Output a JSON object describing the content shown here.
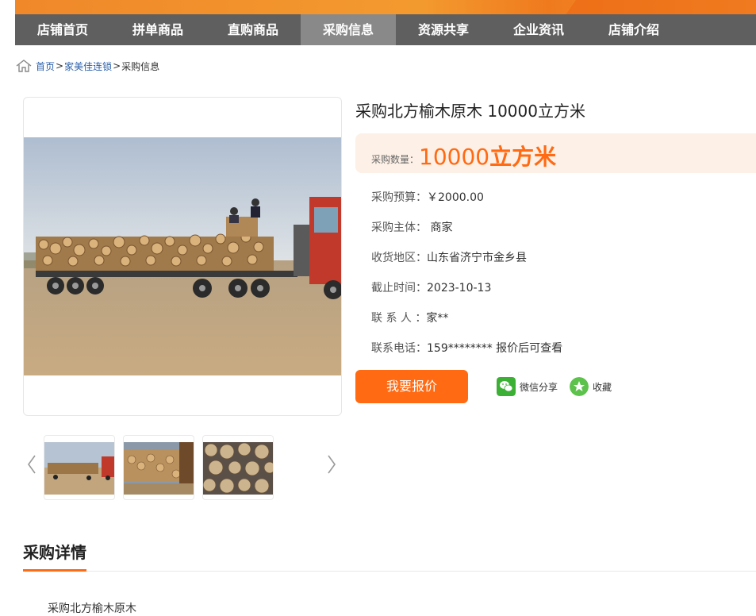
{
  "nav": {
    "items": [
      {
        "label": "店铺首页"
      },
      {
        "label": "拼单商品"
      },
      {
        "label": "直购商品"
      },
      {
        "label": "采购信息",
        "active": true
      },
      {
        "label": "资源共享"
      },
      {
        "label": "企业资讯"
      },
      {
        "label": "店铺介绍"
      }
    ]
  },
  "breadcrumb": {
    "home": "首页",
    "sep": ">",
    "shop": "家美佳连锁",
    "current": "采购信息"
  },
  "product": {
    "title": "采购北方榆木原木 10000立方米",
    "quantity_label": "采购数量：",
    "quantity_value": "10000",
    "quantity_unit": "立方米",
    "budget_label": "采购预算：",
    "budget_value": "￥2000.00",
    "subject_label": "采购主体：",
    "subject_value": "商家",
    "region_label": "收货地区：",
    "region_value": "山东省济宁市金乡县",
    "deadline_label": "截止时间：",
    "deadline_value": "2023-10-13",
    "contact_label": "联 系 人 ：",
    "contact_value": "家**",
    "phone_label": "联系电话：",
    "phone_value": "159******** 报价后可查看"
  },
  "actions": {
    "quote_label": "我要报价",
    "share_label": "微信分享",
    "fav_label": "收藏"
  },
  "section": {
    "title": "采购详情",
    "text": "采购北方榆木原木"
  },
  "colors": {
    "accent": "#ff6a13",
    "nav_bg": "#5f5f5f",
    "nav_active": "#898989",
    "wechat": "#3cb034",
    "fav": "#5cc24b"
  },
  "icons": [
    "home-icon",
    "chevron-left-icon",
    "chevron-right-icon",
    "wechat-icon",
    "star-icon"
  ]
}
